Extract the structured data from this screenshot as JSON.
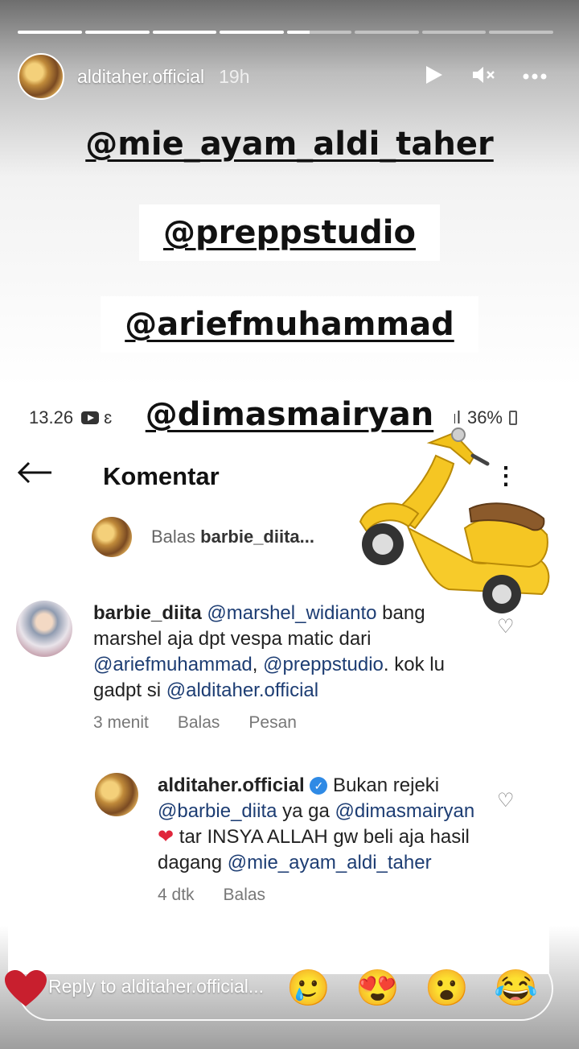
{
  "story": {
    "progress_segments": [
      1,
      1,
      1,
      1,
      0.35,
      0,
      0,
      0
    ],
    "username": "alditaher.official",
    "time": "19h",
    "icons": [
      "play-icon",
      "mute-icon",
      "more-icon"
    ]
  },
  "mentions": [
    "@mie_ayam_aldi_taher",
    "@preppstudio",
    "@ariefmuhammad",
    "@dimasmairyan"
  ],
  "screenshot": {
    "status_time": "13.26",
    "status_extra": "ɛ",
    "signal": ".ıl",
    "battery": "36%",
    "title": "Komentar",
    "reply_to_prefix": "Balas",
    "reply_to_user": "barbie_diita...",
    "comment1": {
      "username": "barbie_diita",
      "mention1": "@marshel_widianto",
      "text1": " bang marshel aja dpt vespa matic dari ",
      "mention2": "@ariefmuhammad",
      "text2": ", ",
      "mention3": "@preppstudio",
      "text3": ". kok lu gadpt si ",
      "mention4": "@alditaher.official",
      "time": "3 menit",
      "reply": "Balas",
      "message": "Pesan"
    },
    "comment2": {
      "username": "alditaher.official",
      "text1": " Bukan rejeki ",
      "mention1": "@barbie_diita",
      "text2": " ya ga ",
      "mention2": "@dimasmairyan",
      "heart": "❤",
      "text3": " tar INSYA ALLAH gw beli aja hasil dagang ",
      "mention3": "@mie_ayam_aldi_taher",
      "time": "4 dtk",
      "reply": "Balas"
    }
  },
  "reply_bar": {
    "placeholder": "Reply to alditaher.official...",
    "reactions": [
      "🥲",
      "😍",
      "😮",
      "😂"
    ]
  }
}
